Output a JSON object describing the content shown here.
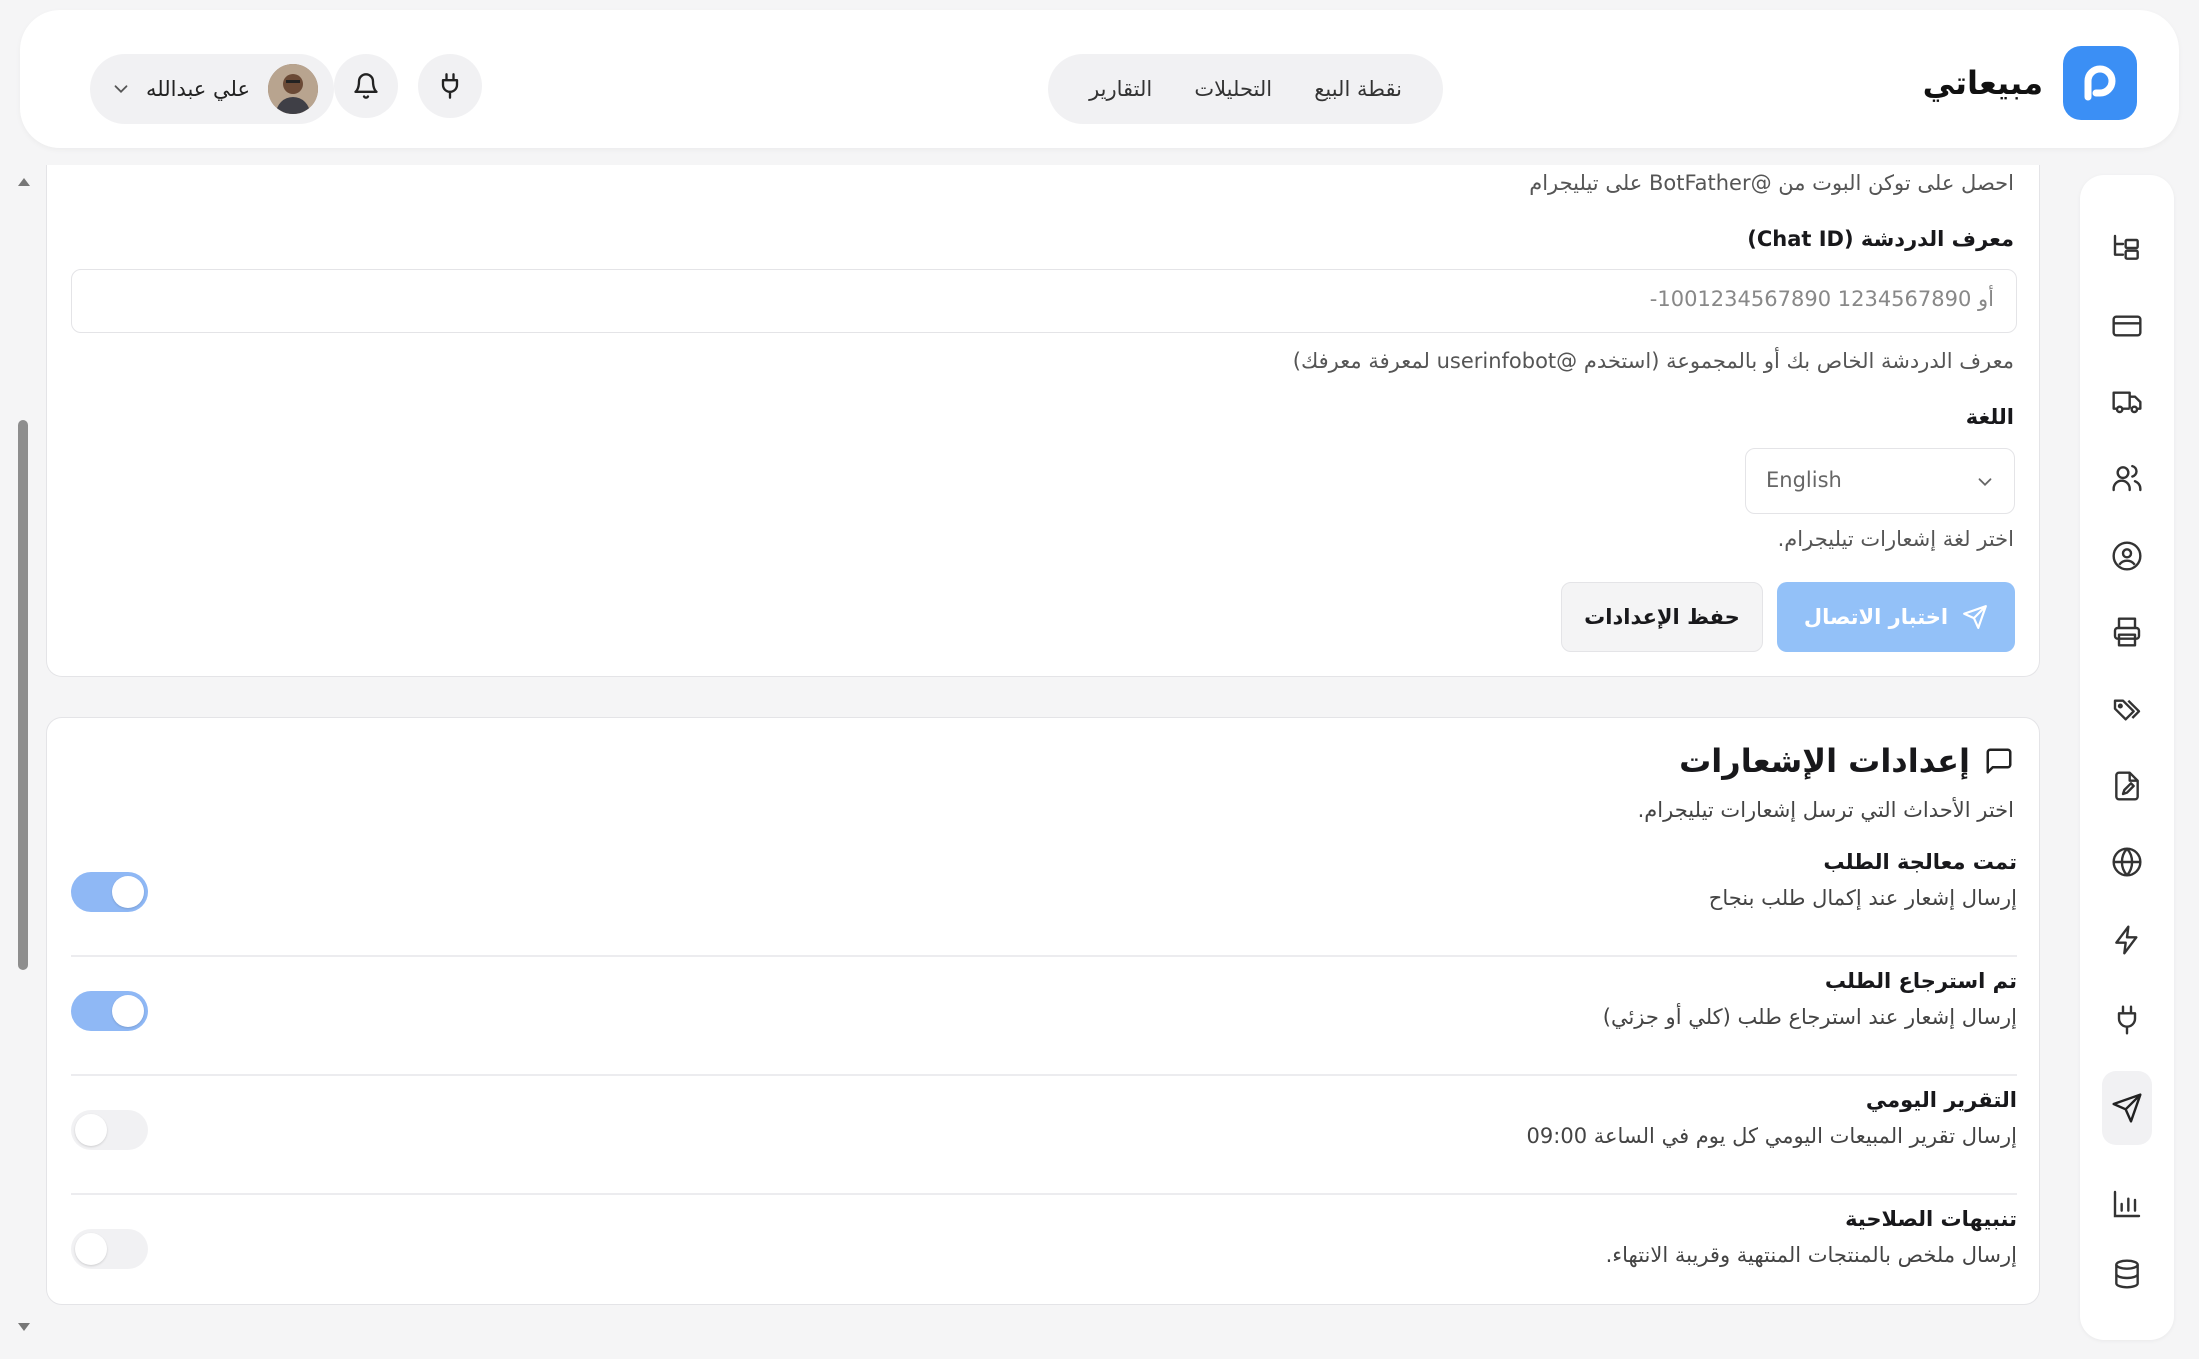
{
  "brand": {
    "name": "مبيعاتي",
    "accent": "#3b8ff5"
  },
  "nav": {
    "items": [
      "نقطة البيع",
      "التحليلات",
      "التقارير"
    ]
  },
  "user": {
    "name": "علي عبدالله"
  },
  "telegram_settings": {
    "token_hint": "احصل على توكن البوت من @BotFather على تيليجرام",
    "chat_id_label": "معرف الدردشة (Chat ID)",
    "chat_id_placeholder": "-1001234567890 أو 1234567890",
    "chat_id_hint": "معرف الدردشة الخاص بك أو بالمجموعة (استخدم @userinfobot لمعرفة معرفك)",
    "language_label": "اللغة",
    "language_value": "English",
    "language_hint": "اختر لغة إشعارات تيليجرام.",
    "test_button": "اختبار الاتصال",
    "save_button": "حفظ الإعدادات"
  },
  "notifications": {
    "title": "إعدادات الإشعارات",
    "subtitle": "اختر الأحداث التي ترسل إشعارات تيليجرام.",
    "items": [
      {
        "title": "تمت معالجة الطلب",
        "desc": "إرسال إشعار عند إكمال طلب بنجاح",
        "enabled": true
      },
      {
        "title": "تم استرجاع الطلب",
        "desc": "إرسال إشعار عند استرجاع طلب (كلي أو جزئي)",
        "enabled": true
      },
      {
        "title": "التقرير اليومي",
        "desc": "إرسال تقرير المبيعات اليومي كل يوم في الساعة 09:00",
        "enabled": false
      },
      {
        "title": "تنبيهات الصلاحية",
        "desc": "إرسال ملخص بالمنتجات المنتهية وقريبة الانتهاء.",
        "enabled": false
      }
    ]
  },
  "sidebar_icons": [
    "folder-tree-icon",
    "credit-card-icon",
    "truck-icon",
    "users-icon",
    "user-circle-icon",
    "printer-icon",
    "tags-icon",
    "file-edit-icon",
    "globe-icon",
    "zap-icon",
    "plug-icon",
    "send-icon",
    "bar-chart-icon",
    "database-icon"
  ]
}
